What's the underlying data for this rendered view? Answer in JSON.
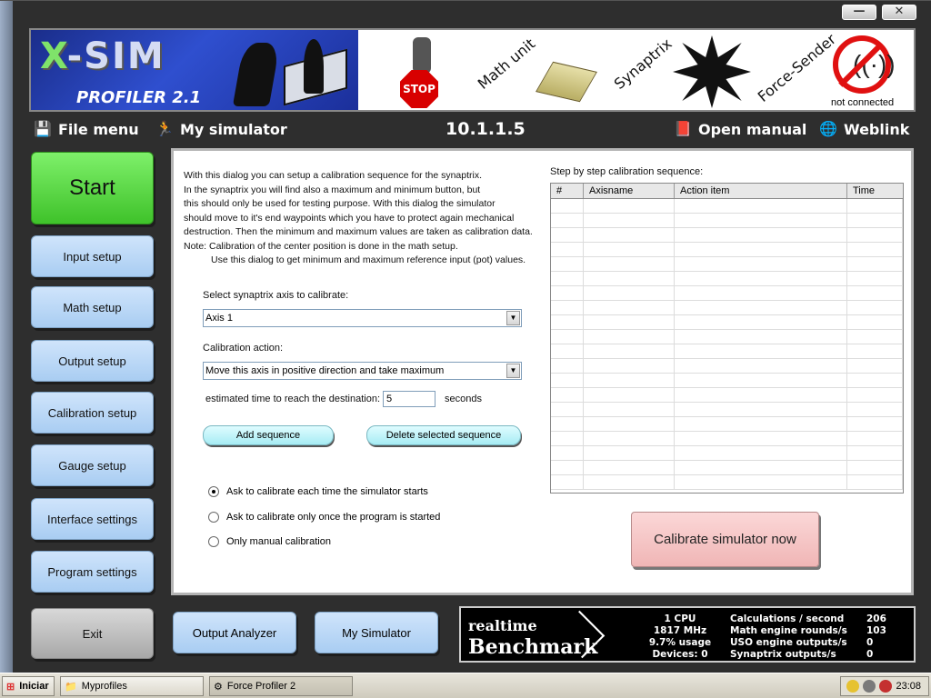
{
  "window": {
    "minimize_glyph": "—",
    "close_glyph": "✕"
  },
  "banner": {
    "logo_x": "X",
    "logo_rest": "-SIM",
    "product": "PROFILER 2.1",
    "stop_text": "STOP",
    "math_unit_label": "Math unit",
    "synaptrix_label": "Synaptrix",
    "force_sender_label": "Force-Sender",
    "status": "not connected",
    "icons": [
      "x-sim-logo-icon",
      "simulator-operator-icon",
      "stop-sign-icon",
      "math-unit-chip-icon",
      "synaptrix-starburst-icon",
      "not-connected-icon"
    ]
  },
  "menu": {
    "file_menu": "File menu",
    "my_simulator": "My simulator",
    "version": "10.1.1.5",
    "open_manual": "Open manual",
    "weblink": "Weblink"
  },
  "nav": {
    "start": "Start",
    "input_setup": "Input setup",
    "math_setup": "Math setup",
    "output_setup": "Output setup",
    "calibration_setup": "Calibration setup",
    "gauge_setup": "Gauge setup",
    "interface_settings": "Interface settings",
    "program_settings": "Program settings",
    "exit": "Exit"
  },
  "calibration": {
    "description": [
      "With this dialog you can setup a calibration sequence for the synaptrix.",
      "In the synaptrix you will find also a maximum and minimum button, but",
      "this should only be used for testing purpose. With this dialog the simulator",
      "should move to it's end waypoints which you have to protect again mechanical",
      "destruction. Then the minimum and maximum values are taken as calibration data.",
      "Note: Calibration of the center position is done in the math setup.",
      "      Use this dialog to get minimum and maximum reference input (pot) values."
    ],
    "axis_label": "Select synaptrix axis to calibrate:",
    "axis_value": "Axis 1",
    "action_label": "Calibration action:",
    "action_value": "Move this axis in positive direction and take maximum",
    "time_label": "estimated time to reach the destination:",
    "time_value": "5",
    "time_unit": "seconds",
    "add_sequence": "Add sequence",
    "delete_sequence": "Delete selected sequence",
    "radio_each_start": "Ask to calibrate each time the simulator starts",
    "radio_once": "Ask to calibrate only once the program is started",
    "radio_manual": "Only manual calibration",
    "selected_radio": "each_start",
    "sequence_title": "Step by step calibration sequence:",
    "columns": [
      "#",
      "Axisname",
      "Action item",
      "Time"
    ],
    "rows": [],
    "calibrate_now": "Calibrate simulator now"
  },
  "bottom": {
    "output_analyzer": "Output Analyzer",
    "my_simulator": "My Simulator"
  },
  "benchmark": {
    "logo_top": "realtime",
    "logo_bottom": "Benchmark",
    "cpu": "1 CPU",
    "mhz": "1817 MHz",
    "usage": "9.7% usage",
    "devices": "Devices: 0",
    "labels": [
      "Calculations / second",
      "Math engine rounds/s",
      "USO engine outputs/s",
      "Synaptrix outputs/s"
    ],
    "values": [
      "206",
      "103",
      "0",
      "0"
    ]
  },
  "taskbar": {
    "start": "Iniciar",
    "myprofiles": "Myprofiles",
    "force_profiler": "Force Profiler 2",
    "clock": "23:08"
  }
}
